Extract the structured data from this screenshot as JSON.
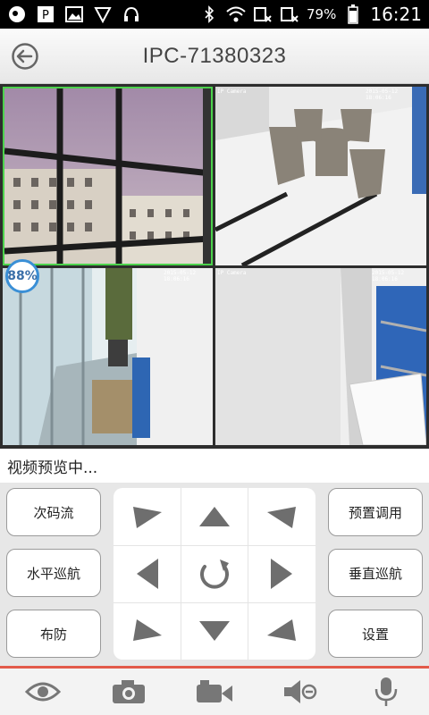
{
  "statusbar": {
    "battery": "79%",
    "time": "16:21"
  },
  "header": {
    "title": "IPC-71380323"
  },
  "video": {
    "tiles": [
      {
        "camera_label": "",
        "timestamp": ""
      },
      {
        "camera_label": "IP Camera",
        "timestamp": "2015-05-12 18:06:16"
      },
      {
        "camera_label": "",
        "timestamp": "2015-05-12 18:06:16"
      },
      {
        "camera_label": "IP Camera",
        "timestamp": "2015-05-12 18:06:16"
      }
    ],
    "loading_percent": "88%"
  },
  "status_text": "视频预览中...",
  "controls": {
    "left": [
      "次码流",
      "水平巡航",
      "布防"
    ],
    "right": [
      "预置调用",
      "垂直巡航",
      "设置"
    ]
  },
  "tabs": [
    "eye-icon",
    "camera-icon",
    "video-icon",
    "speaker-mute-icon",
    "microphone-icon"
  ],
  "colors": {
    "accent": "#e25a4a",
    "selected_tile": "#4cd24c",
    "badge": "#3a8fd6"
  }
}
